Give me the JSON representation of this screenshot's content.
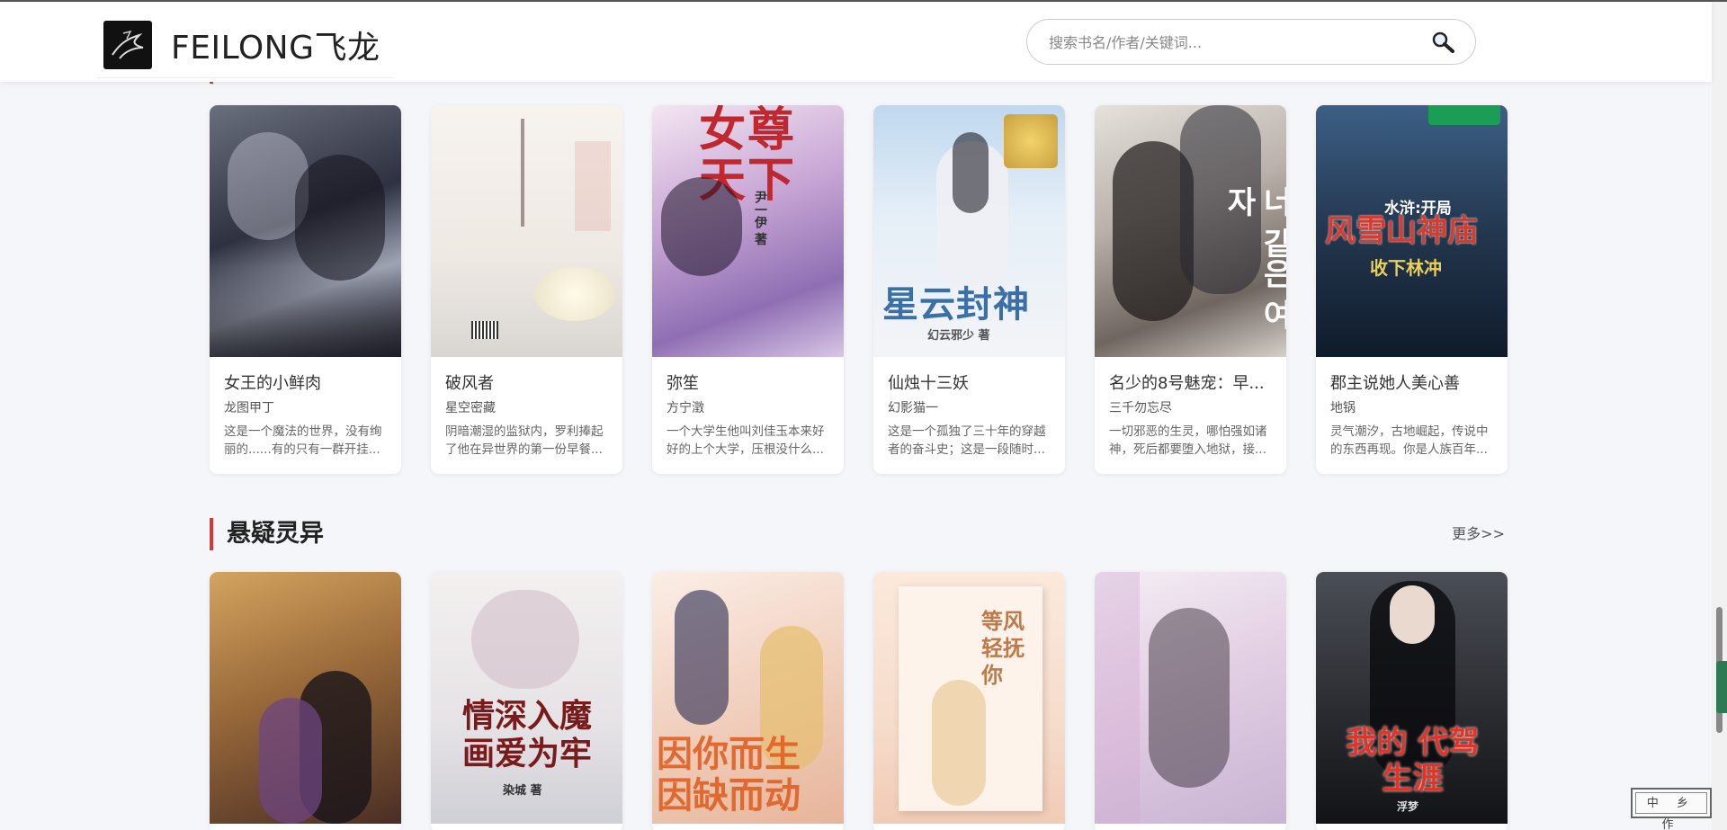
{
  "header": {
    "brand": "FEILONG飞龙",
    "search_placeholder": "搜索书名/作者/关键词..."
  },
  "row1_books": [
    {
      "title": "女王的小鲜肉",
      "author": "龙图甲丁",
      "desc": "这是一个魔法的世界，没有绚丽的......有的只有一群开挂..."
    },
    {
      "title": "破风者",
      "author": "星空密藏",
      "desc": "阴暗潮湿的监狱内，罗利捧起了他在异世界的第一份早餐..."
    },
    {
      "title": "弥笙",
      "author": "方宁澂",
      "desc": "一个大学生他叫刘佳玉本来好好的上个大学，压根没什么..."
    },
    {
      "title": "仙烛十三妖",
      "author": "幻影猫一",
      "desc": "这是一个孤独了三十年的穿越者的奋斗史；这是一段随时..."
    },
    {
      "title": "名少的8号魅宠：早...",
      "author": "三千勿忘尽",
      "desc": "一切邪恶的生灵，哪怕强如诸神，死后都要堕入地狱，接..."
    },
    {
      "title": "郡主说她人美心善",
      "author": "地锅",
      "desc": "灵气潮汐，古地崛起，传说中的东西再现。你是人族百年..."
    }
  ],
  "cover_text": {
    "c3": "女尊天下",
    "c3_author": "尹一伊 著",
    "c4": "星云封神",
    "c4_author": "幻云邪少 著",
    "c5": "너 같은 여자",
    "c6_top": "水浒:开局",
    "c6": "风雪山神庙",
    "c6_sub": "收下林冲",
    "r2c2": "情深入魔 画爱为牢",
    "r2c2_author": "染城 著",
    "r2c3": "因你而生 因缺而动",
    "r2c4": "等风 轻抚你",
    "r2c6": "我的 代驾生涯",
    "r2c6_author": "浮梦"
  },
  "section": {
    "title": "悬疑灵异",
    "more": "更多>>"
  },
  "stamp": "中 乡 作",
  "colors": {
    "accent": "#d93636"
  }
}
